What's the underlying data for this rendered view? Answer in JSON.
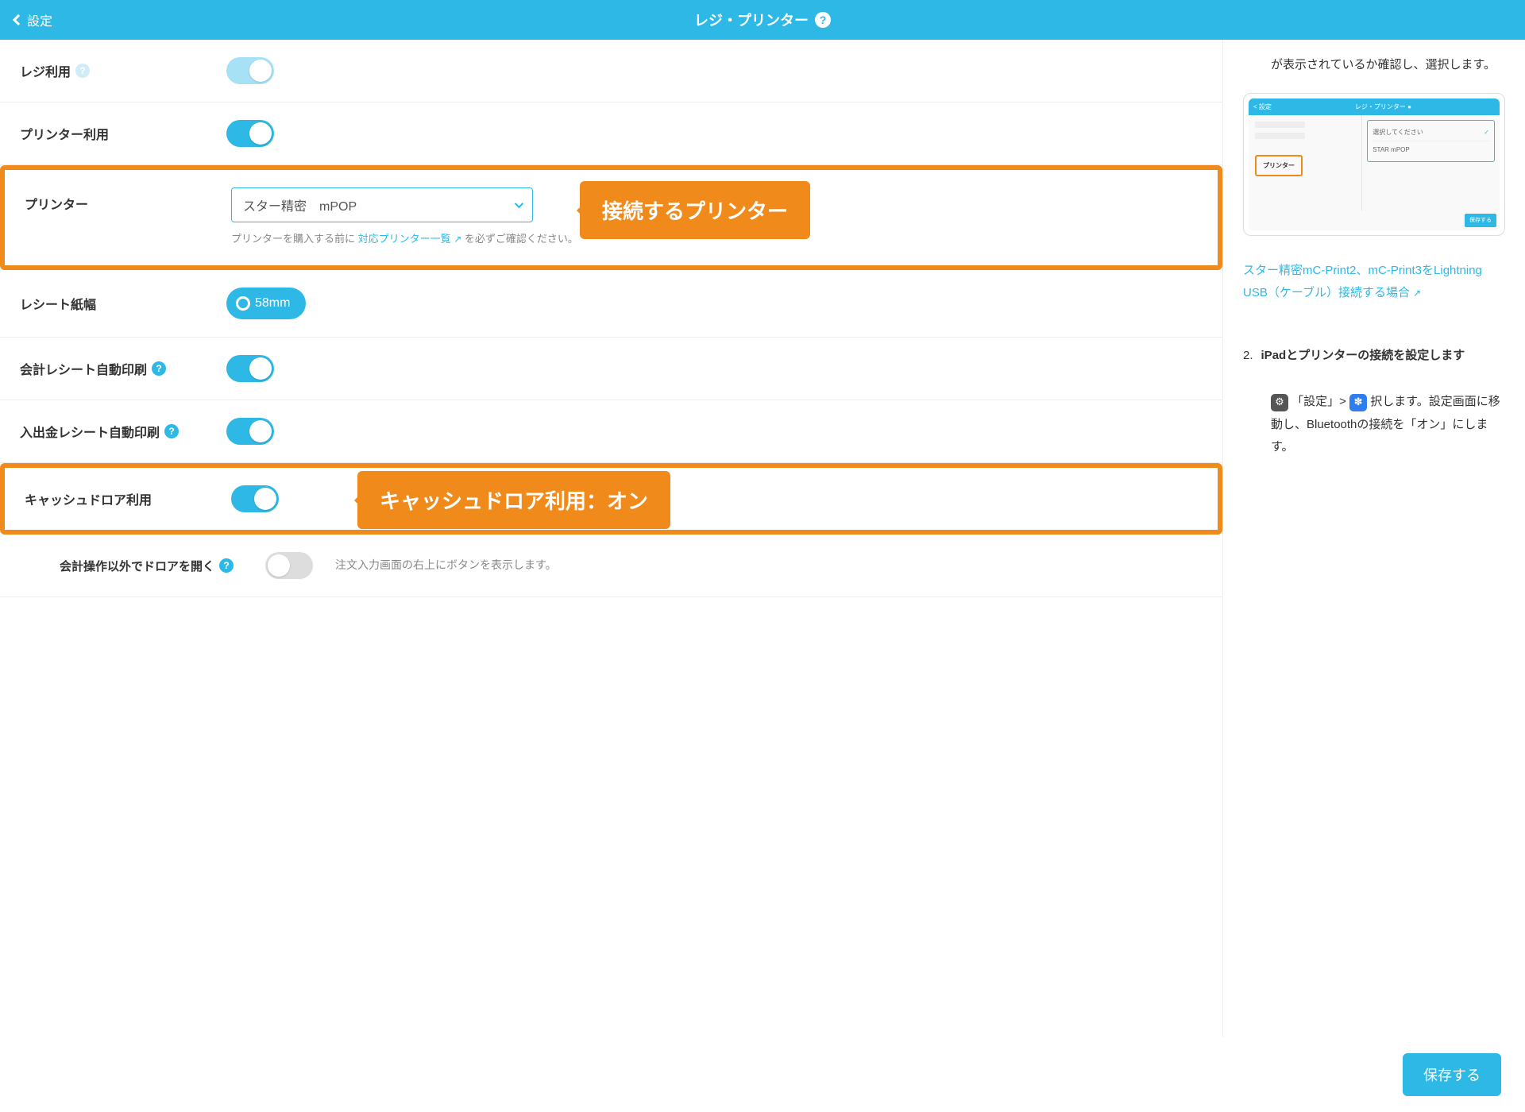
{
  "header": {
    "back": "設定",
    "title": "レジ・プリンター"
  },
  "rows": {
    "register_use": "レジ利用",
    "printer_use": "プリンター利用",
    "printer": "プリンター",
    "printer_value": "スター精密　mPOP",
    "printer_hint_pre": "プリンターを購入する前に ",
    "printer_hint_link": "対応プリンター一覧 ",
    "printer_hint_post": " を必ずご確認ください。",
    "receipt_width": "レシート紙幅",
    "receipt_width_value": "58mm",
    "receipt_auto": "会計レシート自動印刷",
    "cash_receipt_auto": "入出金レシート自動印刷",
    "drawer_use": "キャッシュドロア利用",
    "drawer_other": "会計操作以外でドロアを開く",
    "drawer_other_desc": "注文入力画面の右上にボタンを表示します。"
  },
  "callouts": {
    "printer": "接続するプリンター",
    "drawer": "キャッシュドロア利用：オン"
  },
  "side": {
    "top": "が表示されているか確認し、選択します。",
    "thumb_hdr_title": "レジ・プリンター ●",
    "thumb_hdr_back": "< 設定",
    "thumb_opt1": "選択してください",
    "thumb_opt2": "STAR mPOP",
    "thumb_tag": "プリンター",
    "thumb_btn": "保存する",
    "link1": "スター精密mC-Print2、mC-Print3をLightning USB（ケーブル）接続する場合 ",
    "step_num": "2.",
    "step_txt": "iPadとプリンターの接続を設定します",
    "desc_a": "「設定」> ",
    "desc_b": "択します。設定画面に移動し、Bluetoothの接続を「オン」にします。"
  },
  "footer": {
    "save": "保存する"
  }
}
